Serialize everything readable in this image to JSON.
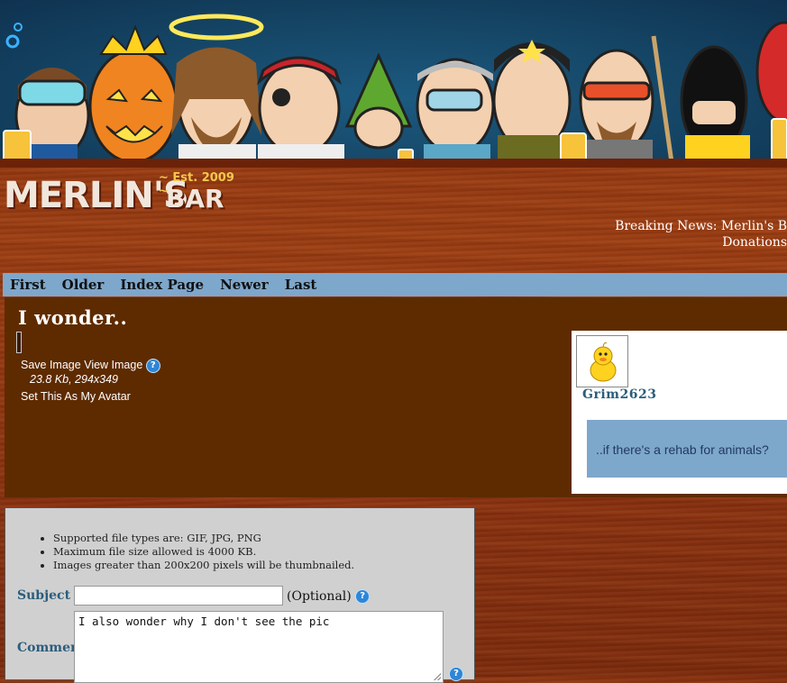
{
  "header": {
    "logo_main": "MERLIN'S",
    "logo_est": "~ Est. 2009 ~",
    "logo_bar": "BAR",
    "news_line1": "Breaking News: Merlin's B",
    "news_line2": "Donations"
  },
  "nav": {
    "items": [
      "First",
      "Older",
      "Index Page",
      "Newer",
      "Last"
    ]
  },
  "post": {
    "title": "I wonder..",
    "save_image": "Save Image",
    "view_image": "View Image",
    "meta": "23.8 Kb, 294x349",
    "set_avatar": "Set This As My Avatar",
    "username": "Grim2623",
    "caption": "..if there's a rehab for animals?"
  },
  "form": {
    "rules": [
      "Supported file types are: GIF, JPG, PNG",
      "Maximum file size allowed is 4000 KB.",
      "Images greater than 200x200 pixels will be thumbnailed."
    ],
    "subject_label": "Subject",
    "subject_value": "",
    "optional_label": "(Optional)",
    "comment_label": "Comment",
    "comment_value": "I also wonder why I don't see the pic"
  },
  "colors": {
    "nav_bg": "#7ea7cc",
    "panel_bg": "#5e2b00",
    "label_blue": "#2b5d7c",
    "help_blue": "#2f86d6"
  }
}
